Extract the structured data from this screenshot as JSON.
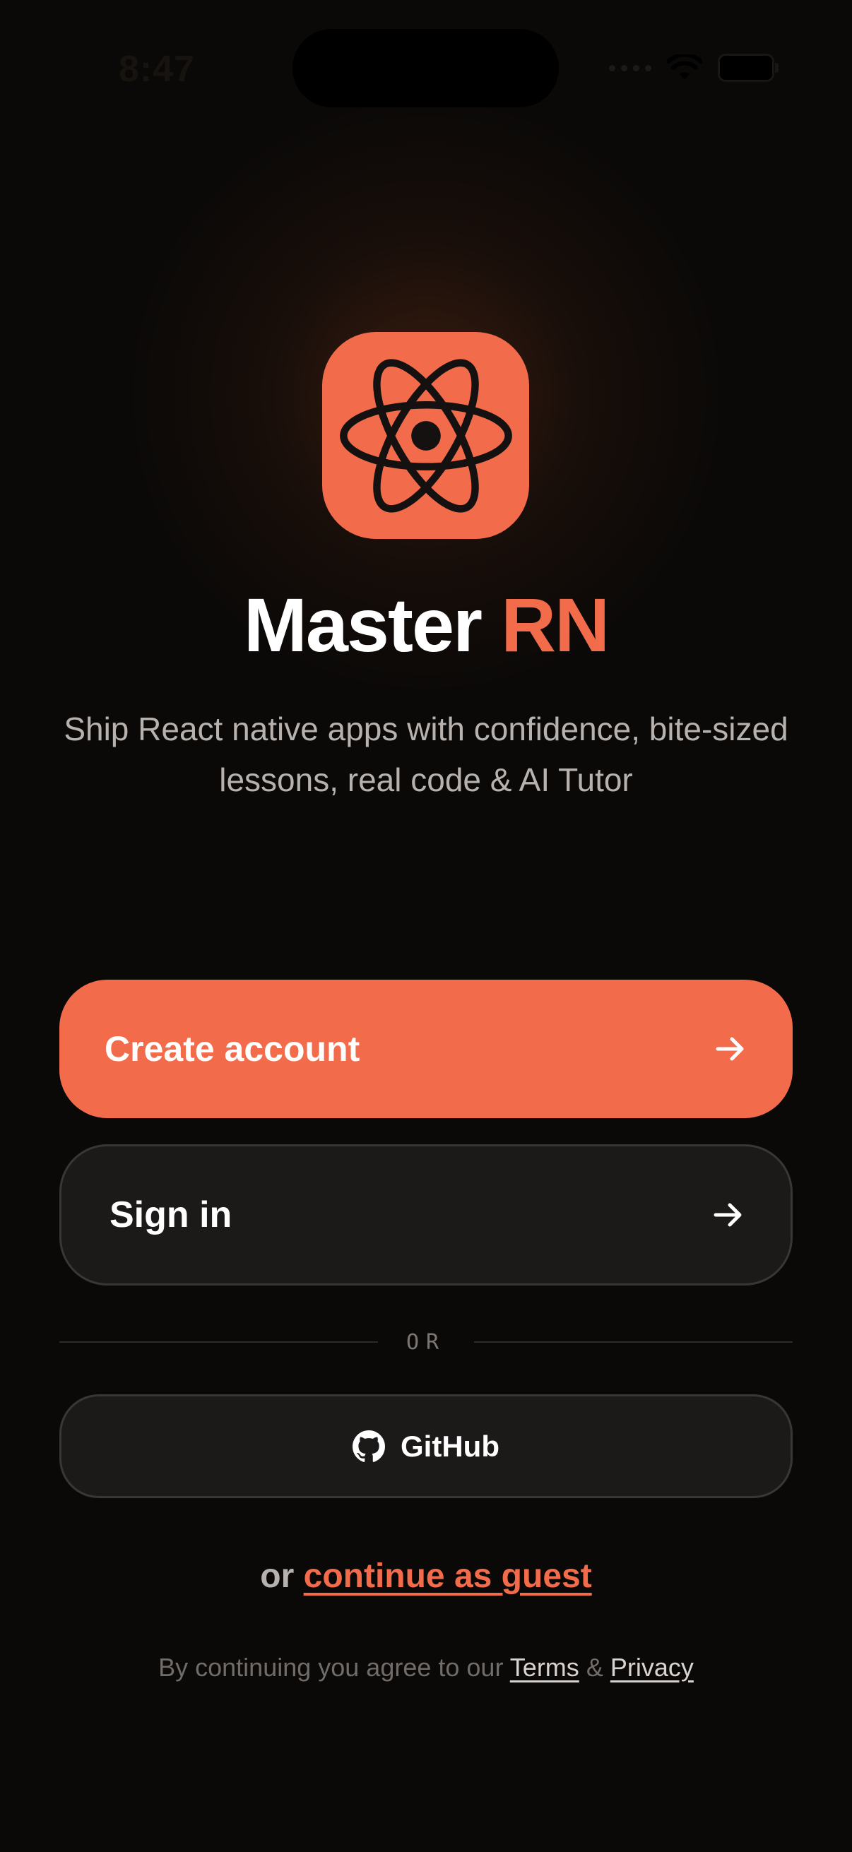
{
  "status_bar": {
    "time": "8:47"
  },
  "app": {
    "title_main": "Master",
    "title_accent": "RN",
    "subtitle": "Ship React native apps with confidence, bite-sized lessons, real code &  AI Tutor"
  },
  "actions": {
    "create_account_label": "Create account",
    "sign_in_label": "Sign in",
    "divider_label": "OR",
    "github_label": "GitHub",
    "guest_prefix": "or",
    "guest_link": "continue as guest"
  },
  "legal": {
    "prefix": "By continuing you agree to our",
    "terms": "Terms",
    "separator": "&",
    "privacy": "Privacy"
  },
  "colors": {
    "accent": "#f26c4b",
    "background": "#0b0908",
    "surface": "#1c1a19"
  },
  "icons": {
    "logo": "react-atom-icon",
    "arrow": "arrow-right-icon",
    "github": "github-icon",
    "wifi": "wifi-icon",
    "battery": "battery-icon"
  }
}
